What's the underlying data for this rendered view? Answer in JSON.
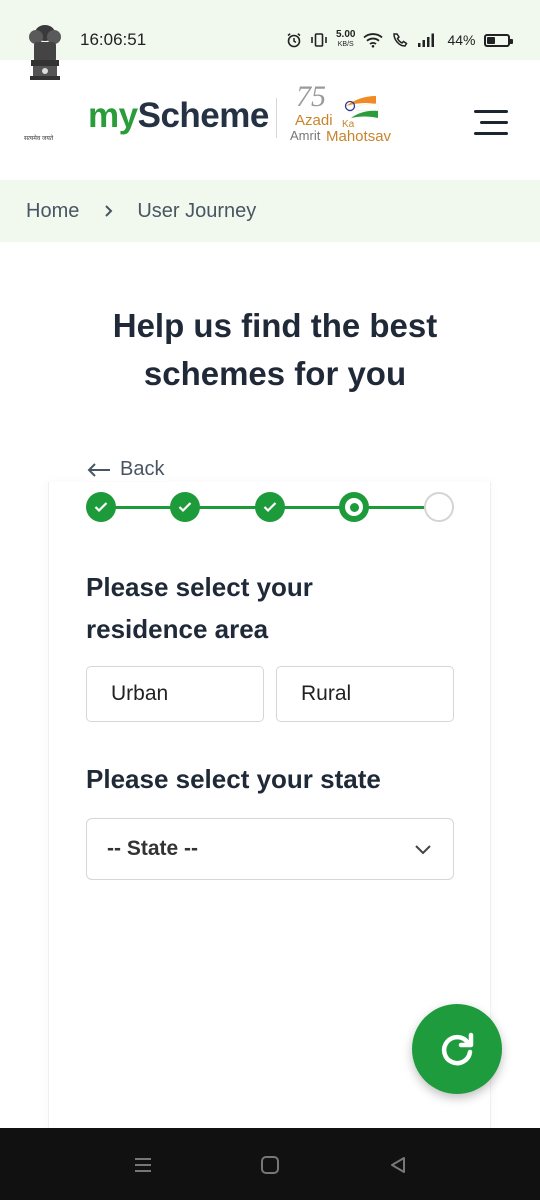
{
  "status_bar": {
    "time": "16:06:51",
    "net_speed": "5.00",
    "net_speed_unit": "KB/S",
    "battery": "44%",
    "battery_level": 0.44
  },
  "header": {
    "brand_my": "my",
    "brand_scheme": "Scheme",
    "emblem_caption": "सत्यमेव जयते",
    "azadi_top": "Azadi",
    "azadi_ka": "Ka",
    "azadi_amrit": "Amrit",
    "azadi_mahotsav": "Mahotsav",
    "azadi_number": "75",
    "menu_icon": "hamburger-menu-icon"
  },
  "breadcrumb": {
    "items": [
      "Home",
      "User Journey"
    ],
    "separator_icon": "chevron-right-icon"
  },
  "main": {
    "title_line1": "Help us find the best",
    "title_line2": "schemes for you",
    "back_label": "Back",
    "steps": [
      "done",
      "done",
      "done",
      "current",
      "todo"
    ],
    "question_area": "Please select your residence area",
    "options_area": [
      "Urban",
      "Rural"
    ],
    "question_state": "Please select your state",
    "state_placeholder": "-- State --"
  },
  "fab": {
    "icon": "refresh-icon"
  },
  "colors": {
    "brand_green": "#2a9d3a",
    "step_green": "#1d9b3a",
    "brand_dark": "#253244",
    "breadcrumb_bg": "#f1f9ef"
  }
}
